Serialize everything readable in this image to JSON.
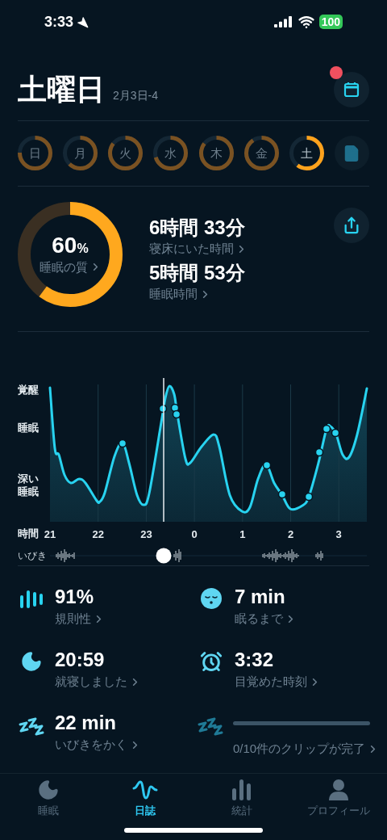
{
  "status_bar": {
    "time": "3:33",
    "battery": "100"
  },
  "header": {
    "title": "土曜日",
    "date": "2月3日-4",
    "calendar_badge": true
  },
  "days": [
    {
      "label": "日",
      "level": 0.75,
      "selected": false
    },
    {
      "label": "月",
      "level": 0.62,
      "selected": false
    },
    {
      "label": "火",
      "level": 0.85,
      "selected": false
    },
    {
      "label": "水",
      "level": 0.7,
      "selected": false
    },
    {
      "label": "木",
      "level": 0.85,
      "selected": false
    },
    {
      "label": "金",
      "level": 0.9,
      "selected": false
    },
    {
      "label": "土",
      "level": 0.6,
      "selected": true
    }
  ],
  "summary": {
    "quality": {
      "value": "60",
      "unit": "%",
      "label": "睡眠の質",
      "level": 0.6
    },
    "metrics": [
      {
        "value": "6時間 33分",
        "label": "寝床にいた時間"
      },
      {
        "value": "5時間 53分",
        "label": "睡眠時間"
      }
    ]
  },
  "chart": {
    "y_labels": [
      "覚醒",
      "睡眠",
      "深い睡眠"
    ],
    "x_title": "時間",
    "x_labels": [
      "21",
      "22",
      "23",
      "0",
      "1",
      "2",
      "3"
    ],
    "snore_label": "いびき"
  },
  "stats": [
    {
      "kind": "regularity",
      "value": "91%",
      "label": "規則性"
    },
    {
      "kind": "fall_asleep",
      "value": "7 min",
      "label": "眠るまで"
    },
    {
      "kind": "bedtime",
      "value": "20:59",
      "label": "就寝しました"
    },
    {
      "kind": "wake",
      "value": "3:32",
      "label": "目覚めた時刻"
    },
    {
      "kind": "snoring",
      "value": "22 min",
      "label": "いびきをかく"
    },
    {
      "kind": "clips",
      "label": "0/10件のクリップが完了"
    }
  ],
  "tabs": [
    {
      "kind": "sleep",
      "label": "睡眠",
      "selected": false
    },
    {
      "kind": "journal",
      "label": "日誌",
      "selected": true
    },
    {
      "kind": "stats",
      "label": "統計",
      "selected": false
    },
    {
      "kind": "profile",
      "label": "プロフィール",
      "selected": false
    }
  ]
}
